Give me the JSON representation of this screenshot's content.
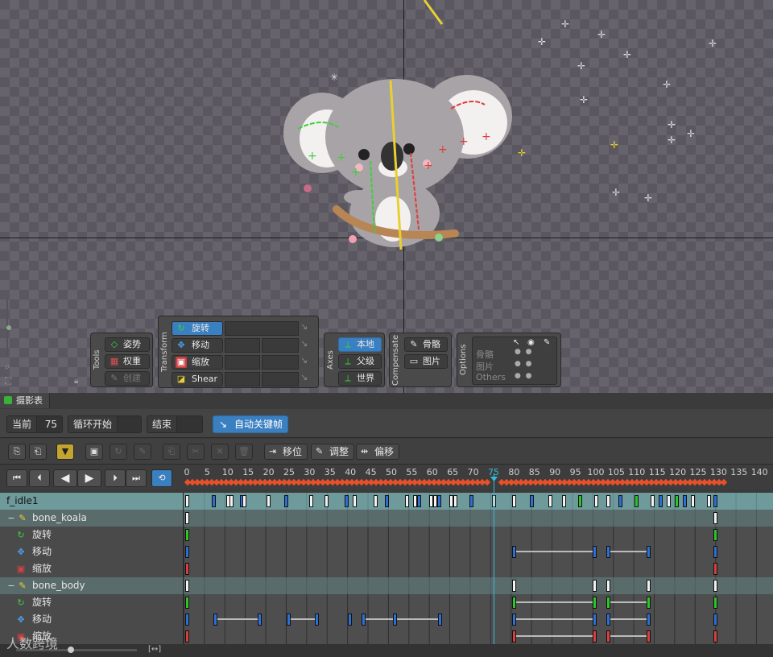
{
  "tools_panel": {
    "title": "Tools",
    "pose": "姿势",
    "weight": "权重",
    "create": "创建"
  },
  "transform_panel": {
    "title": "Transform",
    "rotate": "旋转",
    "move": "移动",
    "scale": "缩放",
    "shear": "Shear"
  },
  "axes_panel": {
    "title": "Axes",
    "local": "本地",
    "parent": "父级",
    "world": "世界"
  },
  "compensate_panel": {
    "title": "Compensate",
    "bones": "骨骼",
    "images": "图片"
  },
  "options_panel": {
    "title": "Options",
    "rows": [
      "骨骼",
      "图片",
      "Others"
    ]
  },
  "dopesheet": {
    "tab": "摄影表",
    "current_label": "当前",
    "current_value": "75",
    "loop_start_label": "循环开始",
    "end_label": "结束",
    "auto_key": "自动关键帧",
    "offset_btn": "移位",
    "adjust_btn": "调整",
    "shift_btn": "偏移"
  },
  "ruler_ticks": [
    "0",
    "5",
    "10",
    "15",
    "20",
    "25",
    "30",
    "35",
    "40",
    "45",
    "50",
    "55",
    "60",
    "65",
    "70",
    "75",
    "80",
    "85",
    "90",
    "95",
    "100",
    "105",
    "110",
    "115",
    "120",
    "125",
    "130",
    "135",
    "140"
  ],
  "current_frame": 75,
  "tracks": [
    {
      "name": "f_idle1",
      "type": "anim"
    },
    {
      "name": "bone_koala",
      "type": "bone"
    },
    {
      "name": "旋转",
      "type": "prop"
    },
    {
      "name": "移动",
      "type": "prop"
    },
    {
      "name": "缩放",
      "type": "prop"
    },
    {
      "name": "bone_body",
      "type": "bone"
    },
    {
      "name": "旋转",
      "type": "prop"
    },
    {
      "name": "移动",
      "type": "prop"
    },
    {
      "name": "缩放",
      "type": "prop"
    }
  ],
  "icons": {
    "rotate": "rotate-icon",
    "move": "move-icon",
    "scale": "scale-icon",
    "shear": "shear-icon",
    "bone": "bone-icon"
  },
  "colors": {
    "accent": "#3a7fc0",
    "playhead": "#35b9d8",
    "key_rotate": "#2cc62c",
    "key_move": "#2f6fd0",
    "key_scale": "#d84040"
  },
  "watermark": "人数跨境"
}
